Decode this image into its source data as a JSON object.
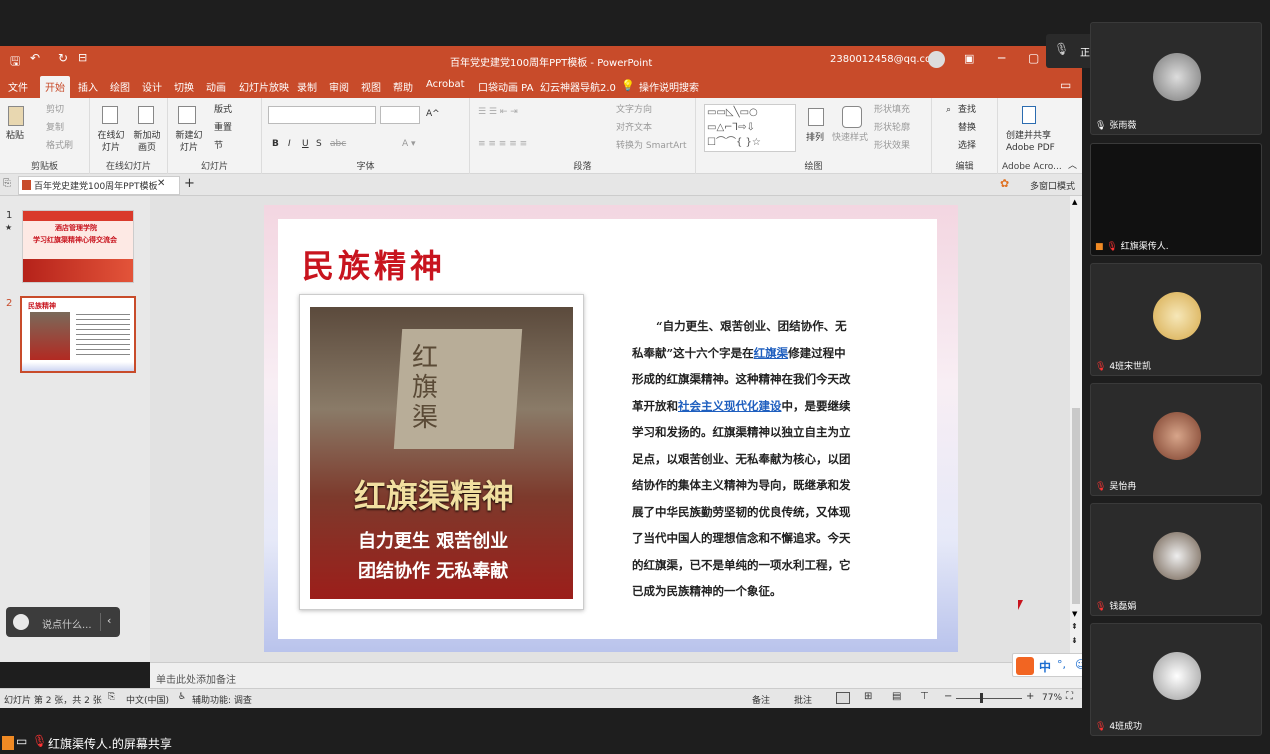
{
  "window": {
    "title": "百年党史建党100周年PPT模板 - PowerPoint",
    "account": "2380012458@qq.com"
  },
  "ribbon_tabs": [
    "文件",
    "开始",
    "插入",
    "绘图",
    "设计",
    "切换",
    "动画",
    "幻灯片放映",
    "录制",
    "审阅",
    "视图",
    "帮助",
    "Acrobat",
    "口袋动画 PA",
    "幻云神器导航2.0",
    "操作说明搜索"
  ],
  "ribbon": {
    "clipboard": {
      "paste": "粘贴",
      "cut": "剪切",
      "copy": "复制",
      "format_painter": "格式刷",
      "label": "剪贴板"
    },
    "online_slides": {
      "online": "在线幻灯片",
      "new_anim": "新加动画页",
      "label": "在线幻灯片"
    },
    "slides": {
      "new_slide": "新建幻灯片",
      "layout": "版式",
      "reset": "重置",
      "section": "节",
      "label": "幻灯片"
    },
    "font": {
      "label": "字体",
      "bold": "B",
      "italic": "I",
      "underline": "U",
      "shadow": "S",
      "strike": "abc"
    },
    "paragraph": {
      "label": "段落",
      "text_direction": "文字方向",
      "align_text": "对齐文本",
      "smartart": "转换为 SmartArt"
    },
    "drawing": {
      "label": "绘图",
      "arrange": "排列",
      "quick_styles": "快速样式",
      "fill": "形状填充",
      "outline": "形状轮廓",
      "effect": "形状效果"
    },
    "editing": {
      "label": "编辑",
      "find": "查找",
      "replace": "替换",
      "select": "选择"
    },
    "adobe": {
      "create": "创建并共享",
      "pdf": "Adobe PDF",
      "label": "Adobe Acro..."
    }
  },
  "doc_tab": {
    "name": "百年党史建党100周年PPT模板",
    "multiwin": "多窗口模式"
  },
  "thumbnails": [
    {
      "num": "1",
      "star": "★",
      "line1": "酒店管理学院",
      "line2": "学习红旗渠精神心得交流会"
    },
    {
      "num": "2",
      "title": "民族精神"
    }
  ],
  "slide": {
    "title": "民族精神",
    "photo_stone": "红旗渠",
    "photo_caption": "红旗渠精神",
    "photo_line1": "自力更生 艰苦创业",
    "photo_line2": "团结协作 无私奉献",
    "body_lines": [
      "“自力更生、艰苦创业、团结协作、无",
      "私奉献”这十六个字是在红旗渠修建过程中",
      "形成的红旗渠精神。这种精神在我们今天改",
      "革开放和社会主义现代化建设中，是要继续",
      "学习和发扬的。红旗渠精神以独立自主为立",
      "足点，以艰苦创业、无私奉献为核心，以团",
      "结协作的集体主义精神为导向，既继承和发",
      "展了中华民族勤劳坚韧的优良传统，又体现",
      "了当代中国人的理想信念和不懈追求。今天",
      "的红旗渠，已不是单纯的一项水利工程，它",
      "已成为民族精神的一个象征。"
    ]
  },
  "notes_placeholder": "单击此处添加备注",
  "status": {
    "slide_info": "幻灯片 第 2 张，共 2 张",
    "language": "中文(中国)",
    "accessibility": "辅助功能: 调查",
    "notes": "备注",
    "comments": "批注",
    "zoom": "77%"
  },
  "meeting": {
    "speaking": "正在讲话:",
    "chat_placeholder": "说点什么...",
    "share_label": "红旗渠传人.的屏幕共享",
    "participants": [
      "张雨薇",
      "红旗渠传人.",
      "4班宋世凯",
      "吴怡冉",
      "钱磊娟",
      "4班成功"
    ]
  },
  "ime": {
    "lang": "中",
    "punct": "°,"
  },
  "colors": {
    "accent": "#c84b2a",
    "slide_title": "#c8141e",
    "link": "#1f5fbf"
  }
}
